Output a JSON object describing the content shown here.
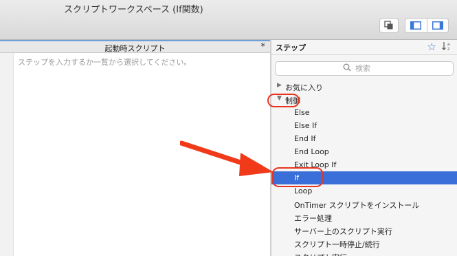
{
  "window": {
    "title": "スクリプトワークスペース (If関数)"
  },
  "editor": {
    "tab_title": "起動時スクリプト",
    "tab_star": "*",
    "placeholder": "ステップを入力するか一覧から選択してください。"
  },
  "steps_panel": {
    "title": "ステップ",
    "sort_label": "↓a/z",
    "search_placeholder": "検索",
    "categories": [
      {
        "label": "お気に入り",
        "expanded": false
      },
      {
        "label": "制御",
        "expanded": true
      }
    ],
    "items": [
      {
        "label": "Else"
      },
      {
        "label": "Else If"
      },
      {
        "label": "End If"
      },
      {
        "label": "End Loop"
      },
      {
        "label": "Exit Loop If"
      },
      {
        "label": "If",
        "selected": true
      },
      {
        "label": "Loop"
      },
      {
        "label": "OnTimer スクリプトをインストール"
      },
      {
        "label": "エラー処理"
      },
      {
        "label": "サーバー上のスクリプト実行"
      },
      {
        "label": "スクリプト一時停止/続行"
      },
      {
        "label": "スクリプト実行"
      }
    ]
  },
  "colors": {
    "selection": "#3a6ed8",
    "annotation": "#e8341e",
    "accent": "#3b78d6"
  },
  "icons": [
    "copy-window-icon",
    "left-panel-icon",
    "right-panel-icon",
    "star-icon",
    "sort-icon",
    "search-icon",
    "disclosure-triangle-icon"
  ]
}
